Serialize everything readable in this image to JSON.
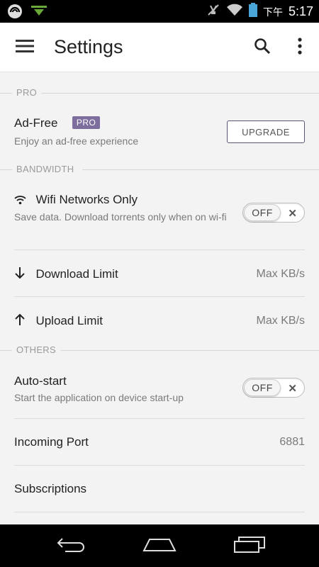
{
  "status_bar": {
    "ampm": "下午",
    "time": "5:17"
  },
  "app_bar": {
    "title": "Settings"
  },
  "sections": {
    "pro": {
      "header": "PRO",
      "ad_free": {
        "title": "Ad-Free",
        "badge": "PRO",
        "subtitle": "Enjoy an ad-free experience",
        "button": "UPGRADE"
      }
    },
    "bandwidth": {
      "header": "BANDWIDTH",
      "wifi_only": {
        "title": "Wifi Networks Only",
        "subtitle": "Save data. Download torrents only when on wi-fi",
        "toggle": "OFF"
      },
      "download_limit": {
        "title": "Download Limit",
        "value": "Max KB/s"
      },
      "upload_limit": {
        "title": "Upload Limit",
        "value": "Max KB/s"
      }
    },
    "others": {
      "header": "OTHERS",
      "auto_start": {
        "title": "Auto-start",
        "subtitle": "Start the application on device start-up",
        "toggle": "OFF"
      },
      "incoming_port": {
        "title": "Incoming Port",
        "value": "6881"
      },
      "subscriptions": {
        "title": "Subscriptions"
      }
    }
  },
  "icons": {
    "status_left": [
      "app-logo-icon",
      "download-notification-icon"
    ],
    "status_right": [
      "vibrate-off-icon",
      "wifi-signal-icon",
      "battery-icon"
    ],
    "app_bar": [
      "menu-icon",
      "search-icon",
      "overflow-menu-icon"
    ],
    "rows": [
      "wifi-icon",
      "arrow-down-icon",
      "arrow-up-icon"
    ],
    "nav": [
      "back-icon",
      "home-icon",
      "recent-apps-icon"
    ]
  },
  "colors": {
    "pro_badge": "#7d6e9d",
    "background": "#f3f3f3",
    "app_bar": "#ffffff"
  }
}
